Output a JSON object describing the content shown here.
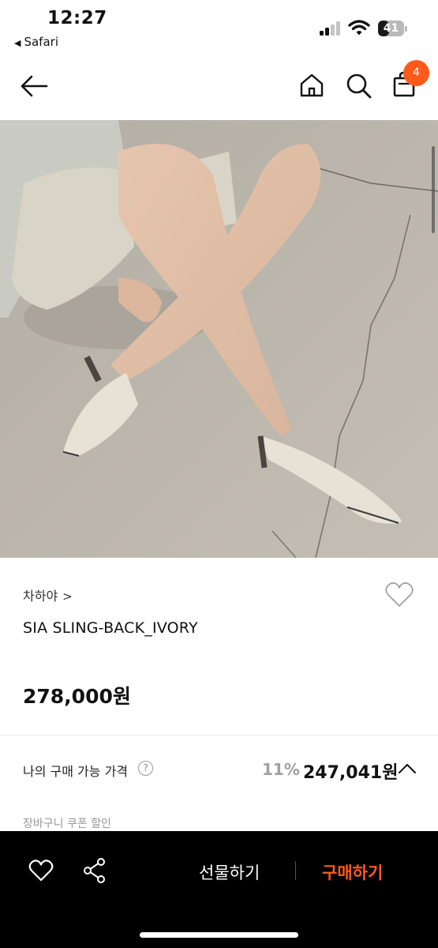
{
  "status_bar": {
    "time": "12:27",
    "back_app": "Safari",
    "battery_level": "41",
    "battery_fraction": 0.41
  },
  "header": {
    "cart_count": "4",
    "accent_color": "#ff5a1a"
  },
  "product": {
    "brand": "차하야",
    "brand_chevron": ">",
    "name": "SIA SLING-BACK_IVORY",
    "price": "278,000원"
  },
  "my_price": {
    "label": "나의 구매 가능 가격",
    "help": "?",
    "discount_rate": "11%",
    "price": "247,041원"
  },
  "coupon": {
    "label": "장바구니 쿠폰 할인"
  },
  "bottom_bar": {
    "gift_label": "선물하기",
    "buy_label": "구매하기",
    "buy_color": "#ff5a1a"
  },
  "icons": [
    "back-arrow-icon",
    "home-icon",
    "search-icon",
    "shopping-bag-icon",
    "heart-icon",
    "share-icon",
    "chevron-up-icon"
  ]
}
